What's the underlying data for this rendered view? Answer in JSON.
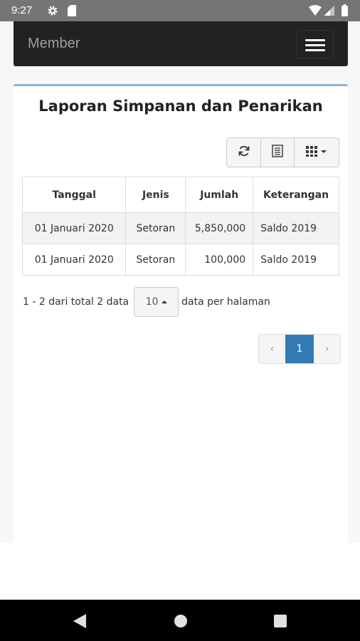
{
  "status_bar": {
    "time": "9:27",
    "icons": [
      "gear-icon",
      "sd-card-icon",
      "wifi-icon",
      "signal-icon",
      "battery-icon"
    ]
  },
  "navbar": {
    "brand": "Member",
    "menu_icon": "hamburger-menu-icon"
  },
  "report": {
    "title": "Laporan Simpanan dan Penarikan",
    "toolbar": {
      "buttons": [
        "refresh-icon",
        "toggle-view-icon",
        "columns-icon"
      ]
    },
    "table": {
      "columns": [
        "Tanggal",
        "Jenis",
        "Jumlah",
        "Keterangan"
      ],
      "rows": [
        [
          "01 Januari 2020",
          "Setoran",
          "5,850,000",
          "Saldo 2019"
        ],
        [
          "01 Januari 2020",
          "Setoran",
          "100,000",
          "Saldo 2019"
        ]
      ]
    },
    "pager": {
      "summary": "1 - 2 dari total 2 data",
      "page_size": "10",
      "page_size_suffix": "data per halaman",
      "prev": "‹",
      "current_page": "1",
      "next": "›"
    }
  },
  "colors": {
    "navbar_bg": "#222222",
    "active_page": "#337ab7",
    "panel_accent": "#8fb1d6"
  }
}
